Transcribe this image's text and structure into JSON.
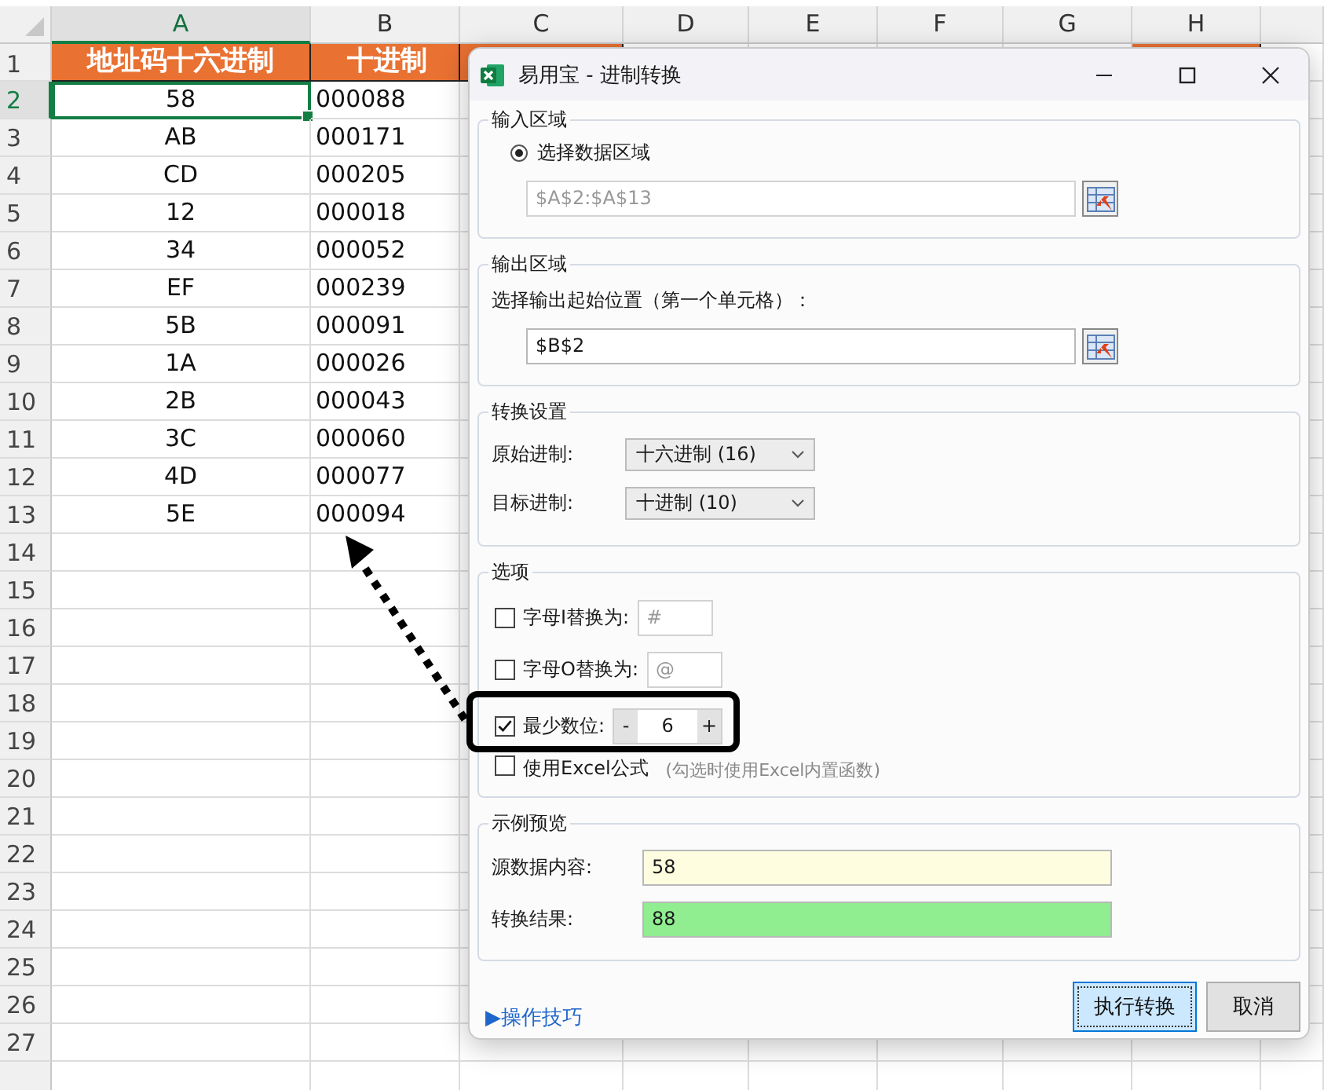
{
  "spreadsheet": {
    "columns": [
      {
        "label": "A",
        "selected": true
      },
      {
        "label": "B",
        "selected": false
      },
      {
        "label": "C",
        "selected": false
      },
      {
        "label": "D",
        "selected": false
      },
      {
        "label": "E",
        "selected": false
      },
      {
        "label": "F",
        "selected": false
      },
      {
        "label": "G",
        "selected": false
      },
      {
        "label": "H",
        "selected": false
      }
    ],
    "rows": [
      {
        "number": "1",
        "kind": "header",
        "selected": false,
        "cells": [
          {
            "text": "地址码十六进制",
            "active": false
          },
          {
            "text": "十进制",
            "active": false
          }
        ]
      },
      {
        "number": "2",
        "kind": "data",
        "selected": true,
        "cells": [
          {
            "text": "58",
            "active": true
          },
          {
            "text": "000088",
            "active": false
          }
        ]
      },
      {
        "number": "3",
        "kind": "data",
        "selected": false,
        "cells": [
          {
            "text": "AB",
            "active": false
          },
          {
            "text": "000171",
            "active": false
          }
        ]
      },
      {
        "number": "4",
        "kind": "data",
        "selected": false,
        "cells": [
          {
            "text": "CD",
            "active": false
          },
          {
            "text": "000205",
            "active": false
          }
        ]
      },
      {
        "number": "5",
        "kind": "data",
        "selected": false,
        "cells": [
          {
            "text": "12",
            "active": false
          },
          {
            "text": "000018",
            "active": false
          }
        ]
      },
      {
        "number": "6",
        "kind": "data",
        "selected": false,
        "cells": [
          {
            "text": "34",
            "active": false
          },
          {
            "text": "000052",
            "active": false
          }
        ]
      },
      {
        "number": "7",
        "kind": "data",
        "selected": false,
        "cells": [
          {
            "text": "EF",
            "active": false
          },
          {
            "text": "000239",
            "active": false
          }
        ]
      },
      {
        "number": "8",
        "kind": "data",
        "selected": false,
        "cells": [
          {
            "text": "5B",
            "active": false
          },
          {
            "text": "000091",
            "active": false
          }
        ]
      },
      {
        "number": "9",
        "kind": "data",
        "selected": false,
        "cells": [
          {
            "text": "1A",
            "active": false
          },
          {
            "text": "000026",
            "active": false
          }
        ]
      },
      {
        "number": "10",
        "kind": "data",
        "selected": false,
        "cells": [
          {
            "text": "2B",
            "active": false
          },
          {
            "text": "000043",
            "active": false
          }
        ]
      },
      {
        "number": "11",
        "kind": "data",
        "selected": false,
        "cells": [
          {
            "text": "3C",
            "active": false
          },
          {
            "text": "000060",
            "active": false
          }
        ]
      },
      {
        "number": "12",
        "kind": "data",
        "selected": false,
        "cells": [
          {
            "text": "4D",
            "active": false
          },
          {
            "text": "000077",
            "active": false
          }
        ]
      },
      {
        "number": "13",
        "kind": "data",
        "selected": false,
        "cells": [
          {
            "text": "5E",
            "active": false
          },
          {
            "text": "000094",
            "active": false
          }
        ]
      },
      {
        "number": "14",
        "kind": "data",
        "selected": false,
        "cells": []
      },
      {
        "number": "15",
        "kind": "data",
        "selected": false,
        "cells": []
      },
      {
        "number": "16",
        "kind": "data",
        "selected": false,
        "cells": []
      },
      {
        "number": "17",
        "kind": "data",
        "selected": false,
        "cells": []
      },
      {
        "number": "18",
        "kind": "data",
        "selected": false,
        "cells": []
      },
      {
        "number": "19",
        "kind": "data",
        "selected": false,
        "cells": []
      },
      {
        "number": "20",
        "kind": "data",
        "selected": false,
        "cells": []
      },
      {
        "number": "21",
        "kind": "data",
        "selected": false,
        "cells": []
      },
      {
        "number": "22",
        "kind": "data",
        "selected": false,
        "cells": []
      },
      {
        "number": "23",
        "kind": "data",
        "selected": false,
        "cells": []
      },
      {
        "number": "24",
        "kind": "data",
        "selected": false,
        "cells": []
      },
      {
        "number": "25",
        "kind": "data",
        "selected": false,
        "cells": []
      },
      {
        "number": "26",
        "kind": "data",
        "selected": false,
        "cells": []
      },
      {
        "number": "27",
        "kind": "data",
        "selected": false,
        "cells": []
      }
    ]
  },
  "dialog": {
    "title": "易用宝 - 进制转换",
    "input_area": {
      "legend": "输入区域",
      "radio": {
        "label": "选择数据区域",
        "selected": true
      },
      "range": "$A$2:$A$13",
      "disabled": true
    },
    "output_area": {
      "legend": "输出区域",
      "label": "选择输出起始位置（第一个单元格）：",
      "range": "$B$2",
      "disabled": false
    },
    "conversion": {
      "legend": "转换设置",
      "rows": [
        {
          "label": "原始进制:",
          "value": "十六进制 (16)"
        },
        {
          "label": "目标进制:",
          "value": "十进制 (10)"
        }
      ]
    },
    "options": {
      "legend": "选项",
      "items": [
        {
          "kind": "replace",
          "label": "字母I替换为:",
          "checked": false,
          "value": "#"
        },
        {
          "kind": "replace",
          "label": "字母O替换为:",
          "checked": false,
          "value": "@"
        },
        {
          "kind": "spinner",
          "label": "最少数位:",
          "checked": true,
          "decrement": "-",
          "value": "6",
          "increment": "+"
        },
        {
          "kind": "hint",
          "label": "使用Excel公式",
          "checked": false,
          "hint": "(勾选时使用Excel内置函数)"
        }
      ]
    },
    "preview": {
      "legend": "示例预览",
      "rows": [
        {
          "label": "源数据内容:",
          "value": "58",
          "color": "#fffde0"
        },
        {
          "label": "转换结果:",
          "value": "88",
          "color": "#90ee90"
        }
      ]
    },
    "link": "▶操作技巧",
    "buttons": [
      {
        "label": "执行转换",
        "default": true
      },
      {
        "label": "取消",
        "default": false
      }
    ]
  }
}
